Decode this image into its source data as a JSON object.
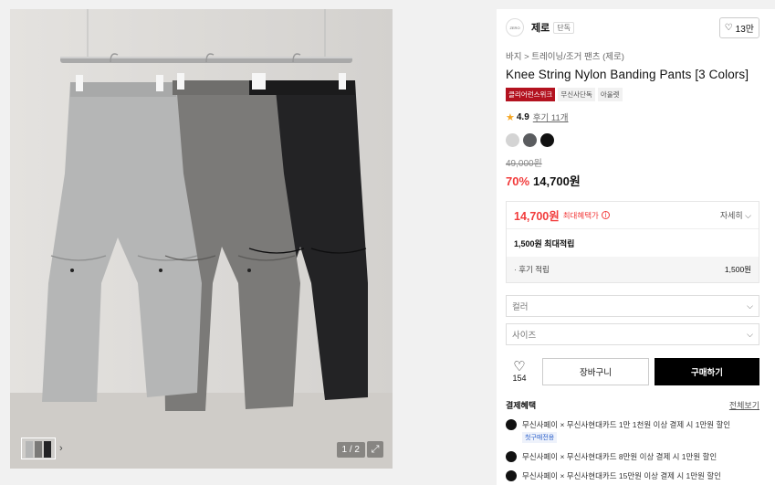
{
  "gallery": {
    "counter": "1 / 2",
    "expand_icon": "expand-icon",
    "thumb_chevron": "›",
    "pants_colors": [
      "#b5b6b6",
      "#7b7a78",
      "#232325"
    ]
  },
  "brand": {
    "logo_text": "ZERO",
    "name": "제로",
    "tag": "단독",
    "like_count": "13만"
  },
  "breadcrumb": "바지 > 트레이닝/조거 팬츠 (제로)",
  "product": {
    "title": "Knee String Nylon Banding Pants [3 Colors]",
    "badges": [
      "클리어런스위크",
      "무신사단독",
      "아울렛"
    ],
    "rating": "4.9",
    "reviews": "후기 11개",
    "colors": [
      "#d4d4d4",
      "#5a5c5f",
      "#111111"
    ],
    "original_price": "49,000원",
    "discount": "70%",
    "price": "14,700원"
  },
  "benefit": {
    "price": "14,700원",
    "label": "최대혜택가",
    "detail": "자세히",
    "points": "1,500원 최대적립",
    "sub_label": "· 후기 적립",
    "sub_value": "1,500원"
  },
  "options": {
    "color_placeholder": "컬러",
    "size_placeholder": "사이즈"
  },
  "actions": {
    "wish_count": "154",
    "cart": "장바구니",
    "buy": "구매하기"
  },
  "payment": {
    "heading": "결제혜택",
    "more": "전체보기",
    "rows": [
      {
        "text": "무신사페이 × 무신사현대카드 1만 1천원 이상 결제 시 1만원 할인",
        "note": "첫구매전용"
      },
      {
        "text": "무신사페이 × 무신사현대카드 8만원 이상 결제 시 1만원 할인"
      },
      {
        "text": "무신사페이 × 무신사현대카드 15만원 이상 결제 시 1만원 할인"
      }
    ]
  }
}
